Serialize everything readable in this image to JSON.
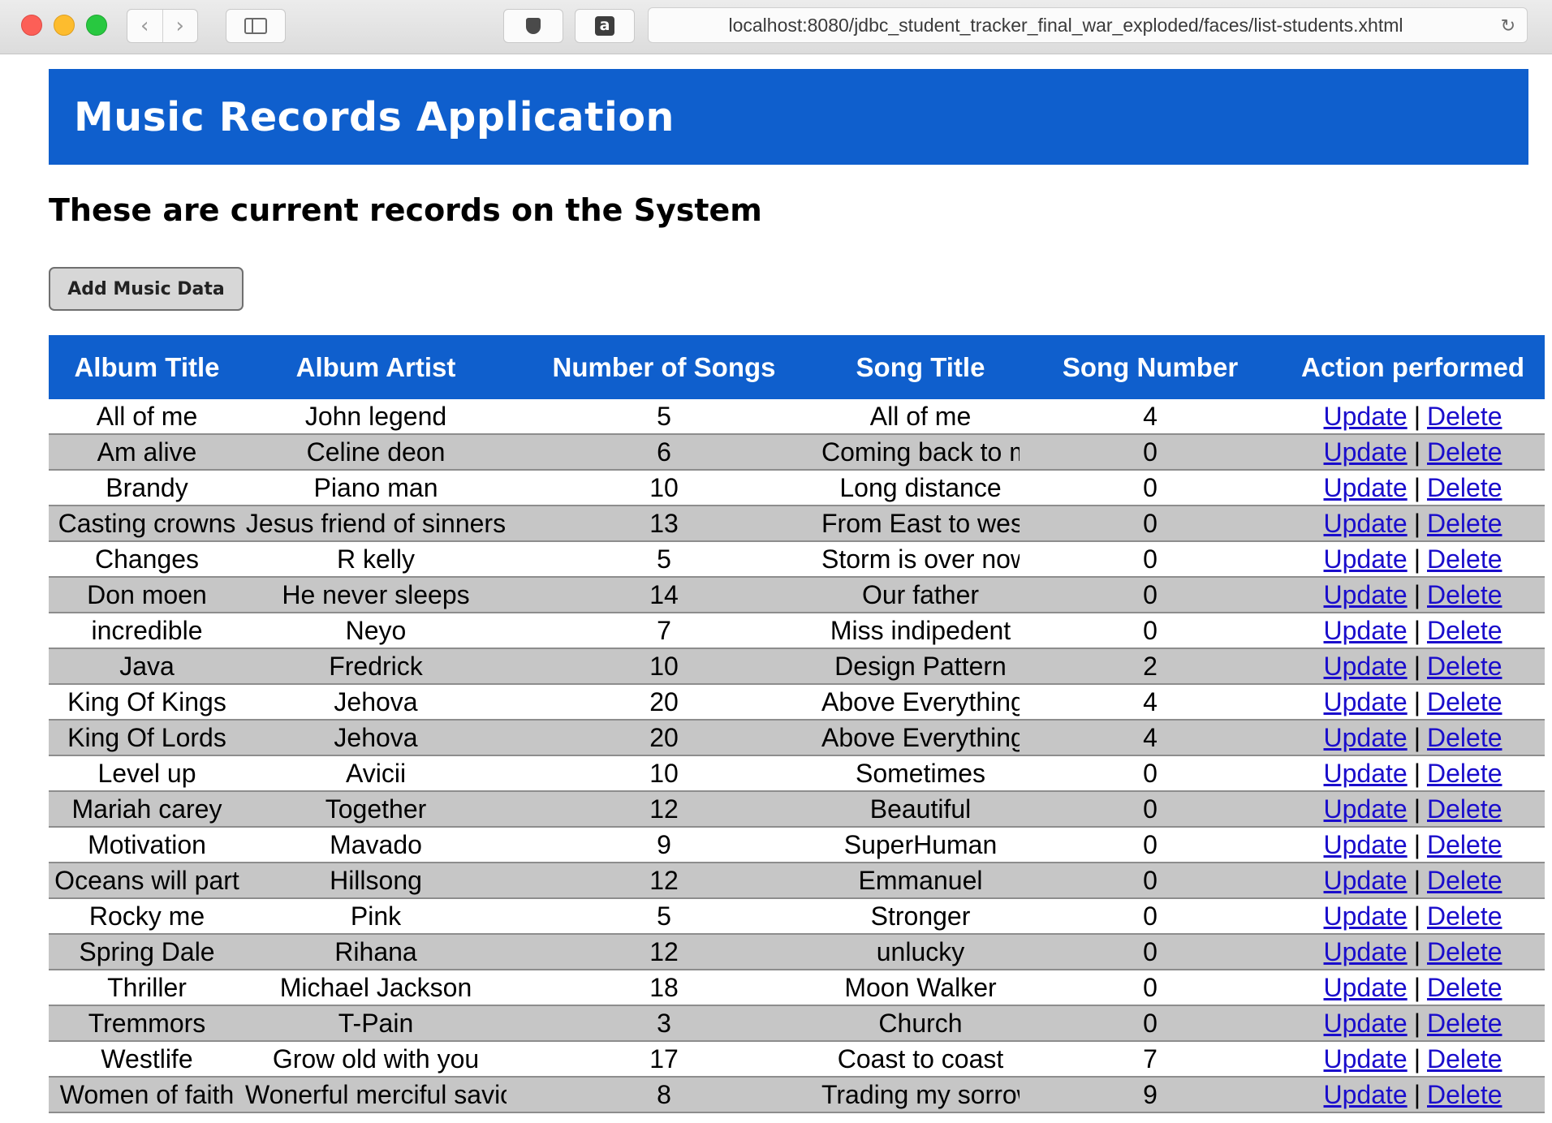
{
  "browser": {
    "url": "localhost:8080/jdbc_student_tracker_final_war_exploded/faces/list-students.xhtml",
    "back_glyph": "‹",
    "forward_glyph": "›",
    "reload_glyph": "↻",
    "amazon_glyph": "a"
  },
  "header": {
    "title": "Music Records Application"
  },
  "main": {
    "subtitle": "These are current records on the System",
    "add_button": "Add Music Data"
  },
  "table": {
    "columns": [
      "Album Title",
      "Album Artist",
      "Number of Songs",
      "Song Title",
      "Song Number",
      "Action performed"
    ],
    "update_label": "Update",
    "separator": "|",
    "delete_label": "Delete",
    "rows": [
      {
        "album": "All of me",
        "artist": "John legend",
        "num_songs": "5",
        "song": "All of me",
        "song_number": "4"
      },
      {
        "album": "Am alive",
        "artist": "Celine deon",
        "num_songs": "6",
        "song": "Coming back to me",
        "song_number": "0"
      },
      {
        "album": "Brandy",
        "artist": "Piano man",
        "num_songs": "10",
        "song": "Long distance",
        "song_number": "0"
      },
      {
        "album": "Casting crowns",
        "artist": "Jesus friend of sinners",
        "num_songs": "13",
        "song": "From East to west",
        "song_number": "0"
      },
      {
        "album": "Changes",
        "artist": "R kelly",
        "num_songs": "5",
        "song": "Storm is over now",
        "song_number": "0"
      },
      {
        "album": "Don moen",
        "artist": "He never sleeps",
        "num_songs": "14",
        "song": "Our father",
        "song_number": "0"
      },
      {
        "album": "incredible",
        "artist": "Neyo",
        "num_songs": "7",
        "song": "Miss indipedent",
        "song_number": "0"
      },
      {
        "album": "Java",
        "artist": "Fredrick",
        "num_songs": "10",
        "song": "Design Pattern",
        "song_number": "2"
      },
      {
        "album": "King Of Kings",
        "artist": "Jehova",
        "num_songs": "20",
        "song": "Above Everything",
        "song_number": "4"
      },
      {
        "album": "King Of Lords",
        "artist": "Jehova",
        "num_songs": "20",
        "song": "Above Everything",
        "song_number": "4"
      },
      {
        "album": "Level up",
        "artist": "Avicii",
        "num_songs": "10",
        "song": "Sometimes",
        "song_number": "0"
      },
      {
        "album": "Mariah carey",
        "artist": "Together",
        "num_songs": "12",
        "song": "Beautiful",
        "song_number": "0"
      },
      {
        "album": "Motivation",
        "artist": "Mavado",
        "num_songs": "9",
        "song": "SuperHuman",
        "song_number": "0"
      },
      {
        "album": "Oceans will part",
        "artist": "Hillsong",
        "num_songs": "12",
        "song": "Emmanuel",
        "song_number": "0"
      },
      {
        "album": "Rocky me",
        "artist": "Pink",
        "num_songs": "5",
        "song": "Stronger",
        "song_number": "0"
      },
      {
        "album": "Spring Dale",
        "artist": "Rihana",
        "num_songs": "12",
        "song": "unlucky",
        "song_number": "0"
      },
      {
        "album": "Thriller",
        "artist": "Michael Jackson",
        "num_songs": "18",
        "song": "Moon Walker",
        "song_number": "0"
      },
      {
        "album": "Tremmors",
        "artist": "T-Pain",
        "num_songs": "3",
        "song": "Church",
        "song_number": "0"
      },
      {
        "album": "Westlife",
        "artist": "Grow old with you",
        "num_songs": "17",
        "song": "Coast to coast",
        "song_number": "7"
      },
      {
        "album": "Women of faith",
        "artist": "Wonerful merciful savior",
        "num_songs": "8",
        "song": "Trading my sorrows",
        "song_number": "9"
      }
    ]
  },
  "colors": {
    "header_blue": "#0f5fcd",
    "even_row": "#c6c6c6",
    "link": "#1a0dcc"
  }
}
